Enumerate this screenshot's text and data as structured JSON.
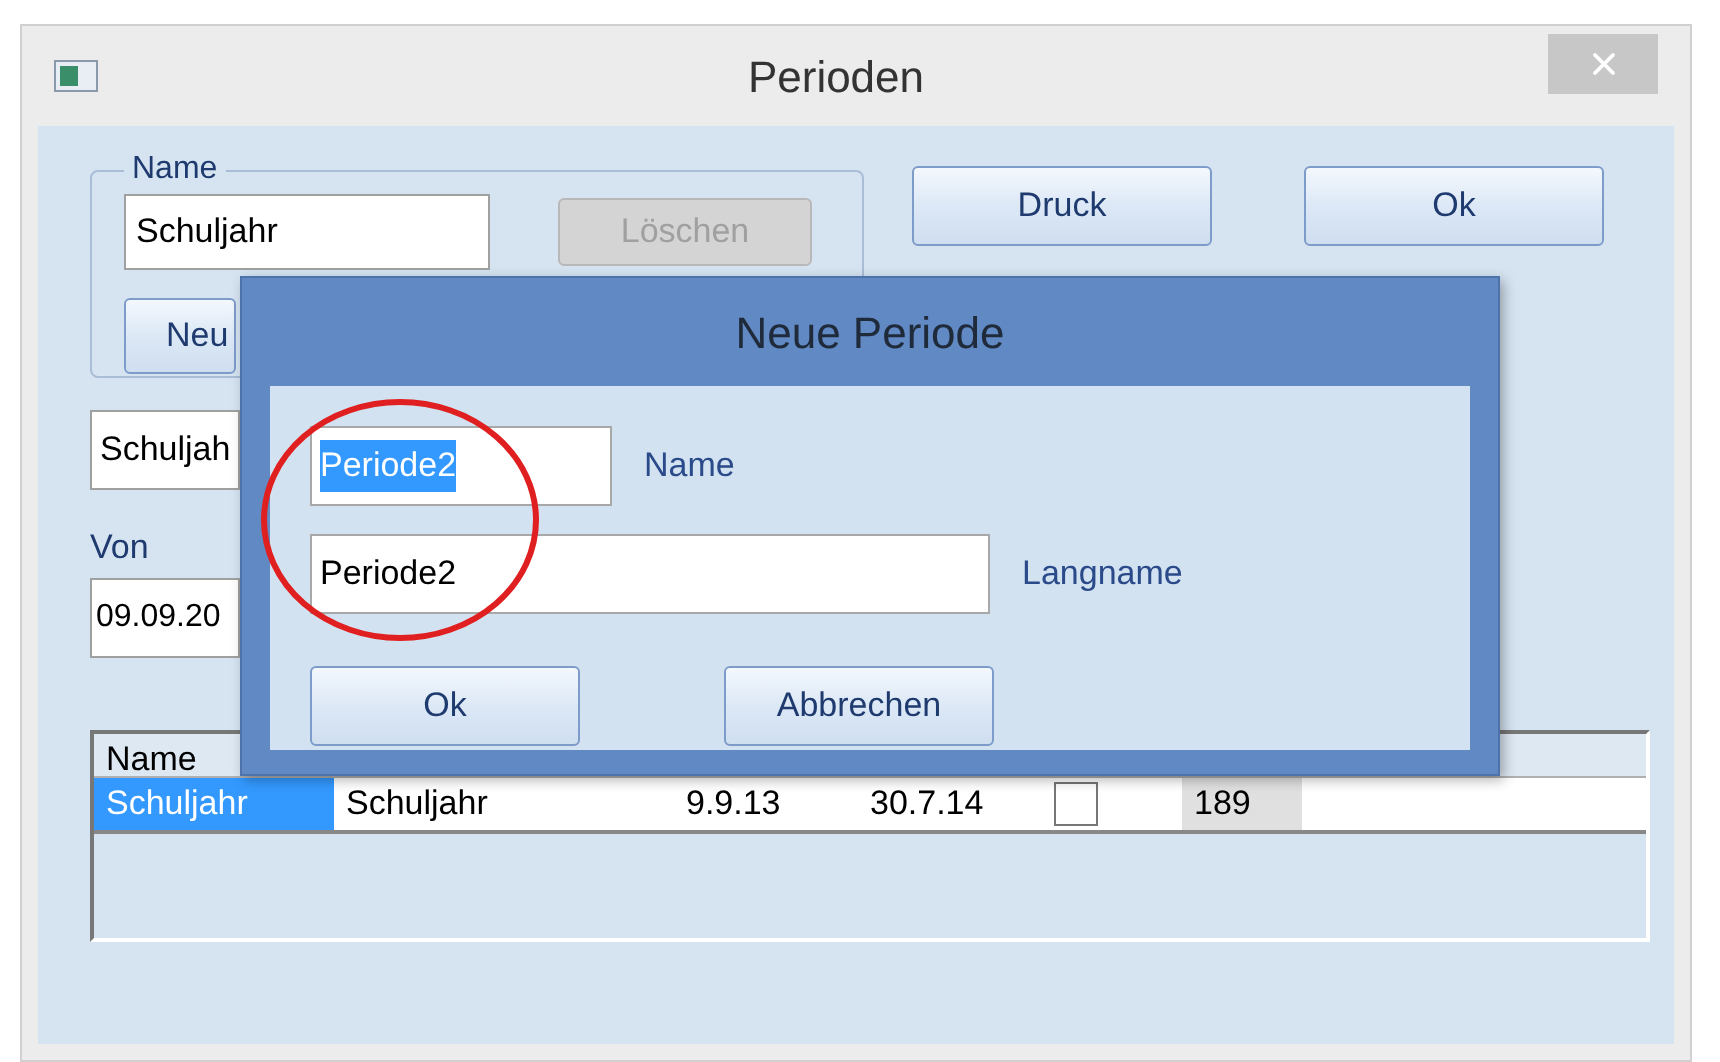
{
  "window": {
    "title": "Perioden"
  },
  "name_group": {
    "legend": "Name",
    "field_value": "Schuljahr",
    "delete_button": {
      "label": "Löschen",
      "disabled": true
    },
    "new_button": {
      "label": "Neu",
      "disabled": false
    }
  },
  "buttons": [
    {
      "label": "Druck"
    },
    {
      "label": "Ok"
    }
  ],
  "short_name_field": "Schuljah",
  "from_label": "Von",
  "from_field": "09.09.20",
  "table": {
    "columns": [
      "Name"
    ],
    "rows": [
      {
        "selected": true,
        "cells": [
          {
            "kind": "text",
            "text": "Schuljahr"
          },
          {
            "kind": "text",
            "text": "Schuljahr"
          },
          {
            "kind": "text",
            "text": "9.9.13"
          },
          {
            "kind": "text",
            "text": "30.7.14"
          },
          {
            "kind": "checkbox",
            "checked": false
          },
          {
            "kind": "text",
            "text": "189"
          }
        ]
      }
    ]
  },
  "dialog": {
    "title": "Neue Periode",
    "fields": [
      {
        "value": "Periode2",
        "label": "Name",
        "selected": true
      },
      {
        "value": "Periode2",
        "label": "Langname",
        "selected": false
      }
    ],
    "buttons": [
      "Ok",
      "Abbrechen"
    ]
  }
}
